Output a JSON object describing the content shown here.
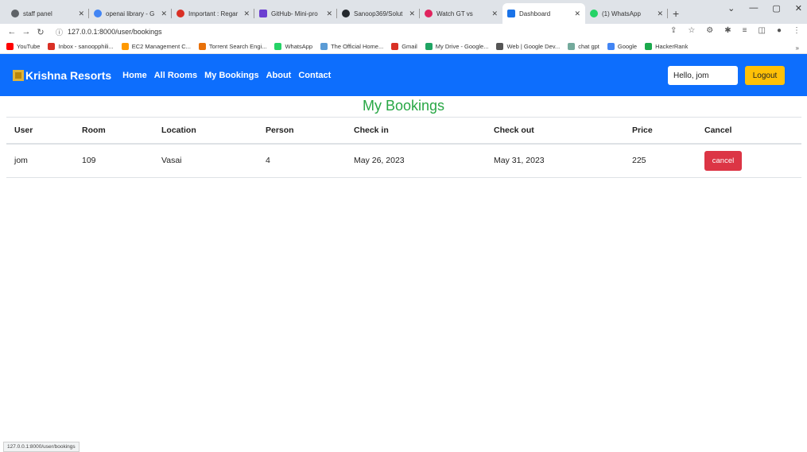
{
  "browser": {
    "tabs": [
      {
        "title": "staff panel",
        "icon": "gear-icon",
        "color": "#5f6368",
        "active": false
      },
      {
        "title": "openai library - G",
        "icon": "google-icon",
        "color": "#4285f4",
        "active": false
      },
      {
        "title": "Important : Regar",
        "icon": "gmail-icon",
        "color": "#d93025",
        "active": false
      },
      {
        "title": "GitHub- Mini-pro",
        "icon": "square-icon",
        "color": "#6b3fd1",
        "active": false
      },
      {
        "title": "Sanoop369/Solut",
        "icon": "github-icon",
        "color": "#24292e",
        "active": false
      },
      {
        "title": "Watch GT vs",
        "icon": "play-icon",
        "color": "#e0245e",
        "active": false
      },
      {
        "title": "Dashboard",
        "icon": "page-icon",
        "color": "#1a73e8",
        "active": true
      },
      {
        "title": "(1) WhatsApp",
        "icon": "whatsapp-icon",
        "color": "#25d366",
        "active": false
      }
    ],
    "url": "127.0.0.1:8000/user/bookings",
    "bookmarks": [
      {
        "label": "YouTube",
        "color": "#ff0000"
      },
      {
        "label": "Inbox - sanoopphili...",
        "color": "#d93025"
      },
      {
        "label": "EC2 Management C...",
        "color": "#ff9900"
      },
      {
        "label": "Torrent Search Engi...",
        "color": "#e8710a"
      },
      {
        "label": "WhatsApp",
        "color": "#25d366"
      },
      {
        "label": "The Official Home...",
        "color": "#5b9bd5"
      },
      {
        "label": "Gmail",
        "color": "#d93025"
      },
      {
        "label": "My Drive - Google...",
        "color": "#1fa463"
      },
      {
        "label": "Web | Google Dev...",
        "color": "#555555"
      },
      {
        "label": "chat gpt",
        "color": "#74aa9c"
      },
      {
        "label": "Google",
        "color": "#4285f4"
      },
      {
        "label": "HackerRank",
        "color": "#1ba94c"
      }
    ],
    "status_url": "127.0.0.1:8000/user/bookings"
  },
  "navbar": {
    "brand": "Krishna Resorts",
    "links": [
      "Home",
      "All Rooms",
      "My Bookings",
      "About",
      "Contact"
    ],
    "greeting": "Hello, jom",
    "logout_label": "Logout",
    "color": "#0d6efd"
  },
  "page": {
    "title": "My Bookings",
    "columns": [
      "User",
      "Room",
      "Location",
      "Person",
      "Check in",
      "Check out",
      "Price",
      "Cancel"
    ],
    "rows": [
      {
        "user": "jom",
        "room": "109",
        "location": "Vasai",
        "person": "4",
        "check_in": "May 26, 2023",
        "check_out": "May 31, 2023",
        "price": "225",
        "cancel_label": "cancel"
      }
    ]
  }
}
